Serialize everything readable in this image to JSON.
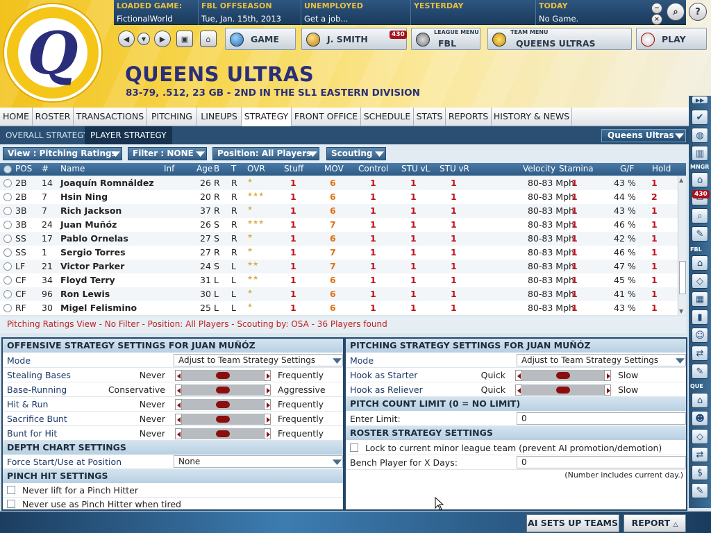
{
  "infobar": [
    {
      "label": "LOADED GAME:",
      "value": "FictionalWorld"
    },
    {
      "label": "FBL OFFSEASON",
      "value": "Tue, Jan. 15th, 2013"
    },
    {
      "label": "UNEMPLOYED",
      "value": "Get a job..."
    },
    {
      "label": "YESTERDAY",
      "value": ""
    },
    {
      "label": "TODAY",
      "value": "No Game."
    }
  ],
  "nav": {
    "game": "GAME",
    "manager": "J. SMITH",
    "manager_badge": "430",
    "league_small": "LEAGUE MENU",
    "league": "FBL",
    "team_small": "TEAM MENU",
    "team": "QUEENS ULTRAS",
    "play": "PLAY"
  },
  "logo_letter": "Q",
  "team": {
    "name": "QUEENS ULTRAS",
    "record": "83-79, .512, 23 GB - 2ND IN THE SL1 EASTERN DIVISION"
  },
  "menu": [
    "HOME",
    "ROSTER",
    "TRANSACTIONS",
    "PITCHING",
    "LINEUPS",
    "STRATEGY",
    "FRONT OFFICE",
    "SCHEDULE",
    "STATS",
    "REPORTS",
    "HISTORY & NEWS"
  ],
  "subtabs": [
    "OVERALL STRATEGY",
    "PLAYER STRATEGY"
  ],
  "team_select": "Queens Ultras",
  "filters": {
    "view": "View : Pitching Ratings",
    "filter": "Filter : NONE",
    "position": "Position: All Players",
    "scouting": "Scouting"
  },
  "columns": [
    "POS",
    "#",
    "Name",
    "Inf",
    "Age",
    "B",
    "T",
    "OVR",
    "Stuff",
    "MOV",
    "Control",
    "STU vL",
    "STU vR",
    "Velocity",
    "Stamina",
    "G/F",
    "Hold"
  ],
  "rows": [
    {
      "pos": "2B",
      "num": "14",
      "name": "Joaquín Romnáldez",
      "age": "26",
      "b": "R",
      "t": "R",
      "ovr": "★",
      "stuff": "1",
      "mov": "6",
      "control": "1",
      "stuvl": "1",
      "stuvr": "1",
      "velo": "80-83 Mph",
      "stamina": "1",
      "gf": "43 %",
      "hold": "1"
    },
    {
      "pos": "2B",
      "num": "7",
      "name": "Hsin Ning",
      "age": "20",
      "b": "R",
      "t": "R",
      "ovr": "★★★",
      "stuff": "1",
      "mov": "6",
      "control": "1",
      "stuvl": "1",
      "stuvr": "1",
      "velo": "80-83 Mph",
      "stamina": "1",
      "gf": "44 %",
      "hold": "2"
    },
    {
      "pos": "3B",
      "num": "7",
      "name": "Rich Jackson",
      "age": "37",
      "b": "R",
      "t": "R",
      "ovr": "★",
      "stuff": "1",
      "mov": "6",
      "control": "1",
      "stuvl": "1",
      "stuvr": "1",
      "velo": "80-83 Mph",
      "stamina": "1",
      "gf": "43 %",
      "hold": "1"
    },
    {
      "pos": "3B",
      "num": "24",
      "name": "Juan Muñóz",
      "age": "26",
      "b": "S",
      "t": "R",
      "ovr": "★★★",
      "stuff": "1",
      "mov": "7",
      "control": "1",
      "stuvl": "1",
      "stuvr": "1",
      "velo": "80-83 Mph",
      "stamina": "1",
      "gf": "46 %",
      "hold": "1"
    },
    {
      "pos": "SS",
      "num": "17",
      "name": "Pablo Ornelas",
      "age": "27",
      "b": "S",
      "t": "R",
      "ovr": "★",
      "stuff": "1",
      "mov": "6",
      "control": "1",
      "stuvl": "1",
      "stuvr": "1",
      "velo": "80-83 Mph",
      "stamina": "1",
      "gf": "42 %",
      "hold": "1"
    },
    {
      "pos": "SS",
      "num": "1",
      "name": "Sergio Torres",
      "age": "27",
      "b": "R",
      "t": "R",
      "ovr": "★",
      "stuff": "1",
      "mov": "7",
      "control": "1",
      "stuvl": "1",
      "stuvr": "1",
      "velo": "80-83 Mph",
      "stamina": "1",
      "gf": "46 %",
      "hold": "1"
    },
    {
      "pos": "LF",
      "num": "21",
      "name": "Victor Parker",
      "age": "24",
      "b": "S",
      "t": "L",
      "ovr": "★★",
      "stuff": "1",
      "mov": "7",
      "control": "1",
      "stuvl": "1",
      "stuvr": "1",
      "velo": "80-83 Mph",
      "stamina": "1",
      "gf": "47 %",
      "hold": "1"
    },
    {
      "pos": "CF",
      "num": "34",
      "name": "Floyd Terry",
      "age": "31",
      "b": "L",
      "t": "L",
      "ovr": "★★",
      "stuff": "1",
      "mov": "6",
      "control": "1",
      "stuvl": "1",
      "stuvr": "1",
      "velo": "80-83 Mph",
      "stamina": "1",
      "gf": "45 %",
      "hold": "1"
    },
    {
      "pos": "CF",
      "num": "96",
      "name": "Ron Lewis",
      "age": "30",
      "b": "L",
      "t": "L",
      "ovr": "★",
      "stuff": "1",
      "mov": "6",
      "control": "1",
      "stuvl": "1",
      "stuvr": "1",
      "velo": "80-83 Mph",
      "stamina": "1",
      "gf": "41 %",
      "hold": "1"
    },
    {
      "pos": "RF",
      "num": "30",
      "name": "Migel Felismino",
      "age": "25",
      "b": "L",
      "t": "L",
      "ovr": "★",
      "stuff": "1",
      "mov": "6",
      "control": "1",
      "stuvl": "1",
      "stuvr": "1",
      "velo": "80-83 Mph",
      "stamina": "1",
      "gf": "43 %",
      "hold": "1"
    }
  ],
  "status_line": "Pitching Ratings View - No Filter - Position: All Players - Scouting by: OSA - 36 Players found",
  "offensive": {
    "title": "OFFENSIVE STRATEGY SETTINGS FOR JUAN MUÑÓZ",
    "mode_label": "Mode",
    "mode_value": "Adjust to Team Strategy Settings",
    "sliders": [
      {
        "label": "Stealing Bases",
        "left": "Never",
        "right": "Frequently",
        "level": 0.5
      },
      {
        "label": "Base-Running",
        "left": "Conservative",
        "right": "Aggressive",
        "level": 0.5
      },
      {
        "label": "Hit & Run",
        "left": "Never",
        "right": "Frequently",
        "level": 0.5
      },
      {
        "label": "Sacrifice Bunt",
        "left": "Never",
        "right": "Frequently",
        "level": 0.5
      },
      {
        "label": "Bunt for Hit",
        "left": "Never",
        "right": "Frequently",
        "level": 0.5
      }
    ],
    "depth_title": "DEPTH CHART SETTINGS",
    "force_label": "Force Start/Use at Position",
    "force_value": "None",
    "pinch_title": "PINCH HIT SETTINGS",
    "pinch_opts": [
      "Never lift for a Pinch Hitter",
      "Never use as Pinch Hitter when tired"
    ]
  },
  "pitching": {
    "title": "PITCHING STRATEGY SETTINGS FOR JUAN MUÑÓZ",
    "mode_label": "Mode",
    "mode_value": "Adjust to Team Strategy Settings",
    "sliders": [
      {
        "label": "Hook as Starter",
        "left": "Quick",
        "right": "Slow",
        "level": 0.5
      },
      {
        "label": "Hook as Reliever",
        "left": "Quick",
        "right": "Slow",
        "level": 0.5
      }
    ],
    "count_title": "PITCH COUNT LIMIT (0 = NO LIMIT)",
    "limit_label": "Enter Limit:",
    "limit_value": "0",
    "roster_title": "ROSTER STRATEGY SETTINGS",
    "lock_label": "Lock to current minor league team (prevent AI promotion/demotion)",
    "bench_label": "Bench Player for X Days:",
    "bench_value": "0",
    "bench_note": "(Number includes current day.)"
  },
  "sidebar": {
    "mngr": "MNGR",
    "fbl": "FBL",
    "que": "QUE",
    "badge": "430"
  },
  "footer": {
    "ai": "AI SETS UP TEAMS",
    "report": "REPORT"
  }
}
